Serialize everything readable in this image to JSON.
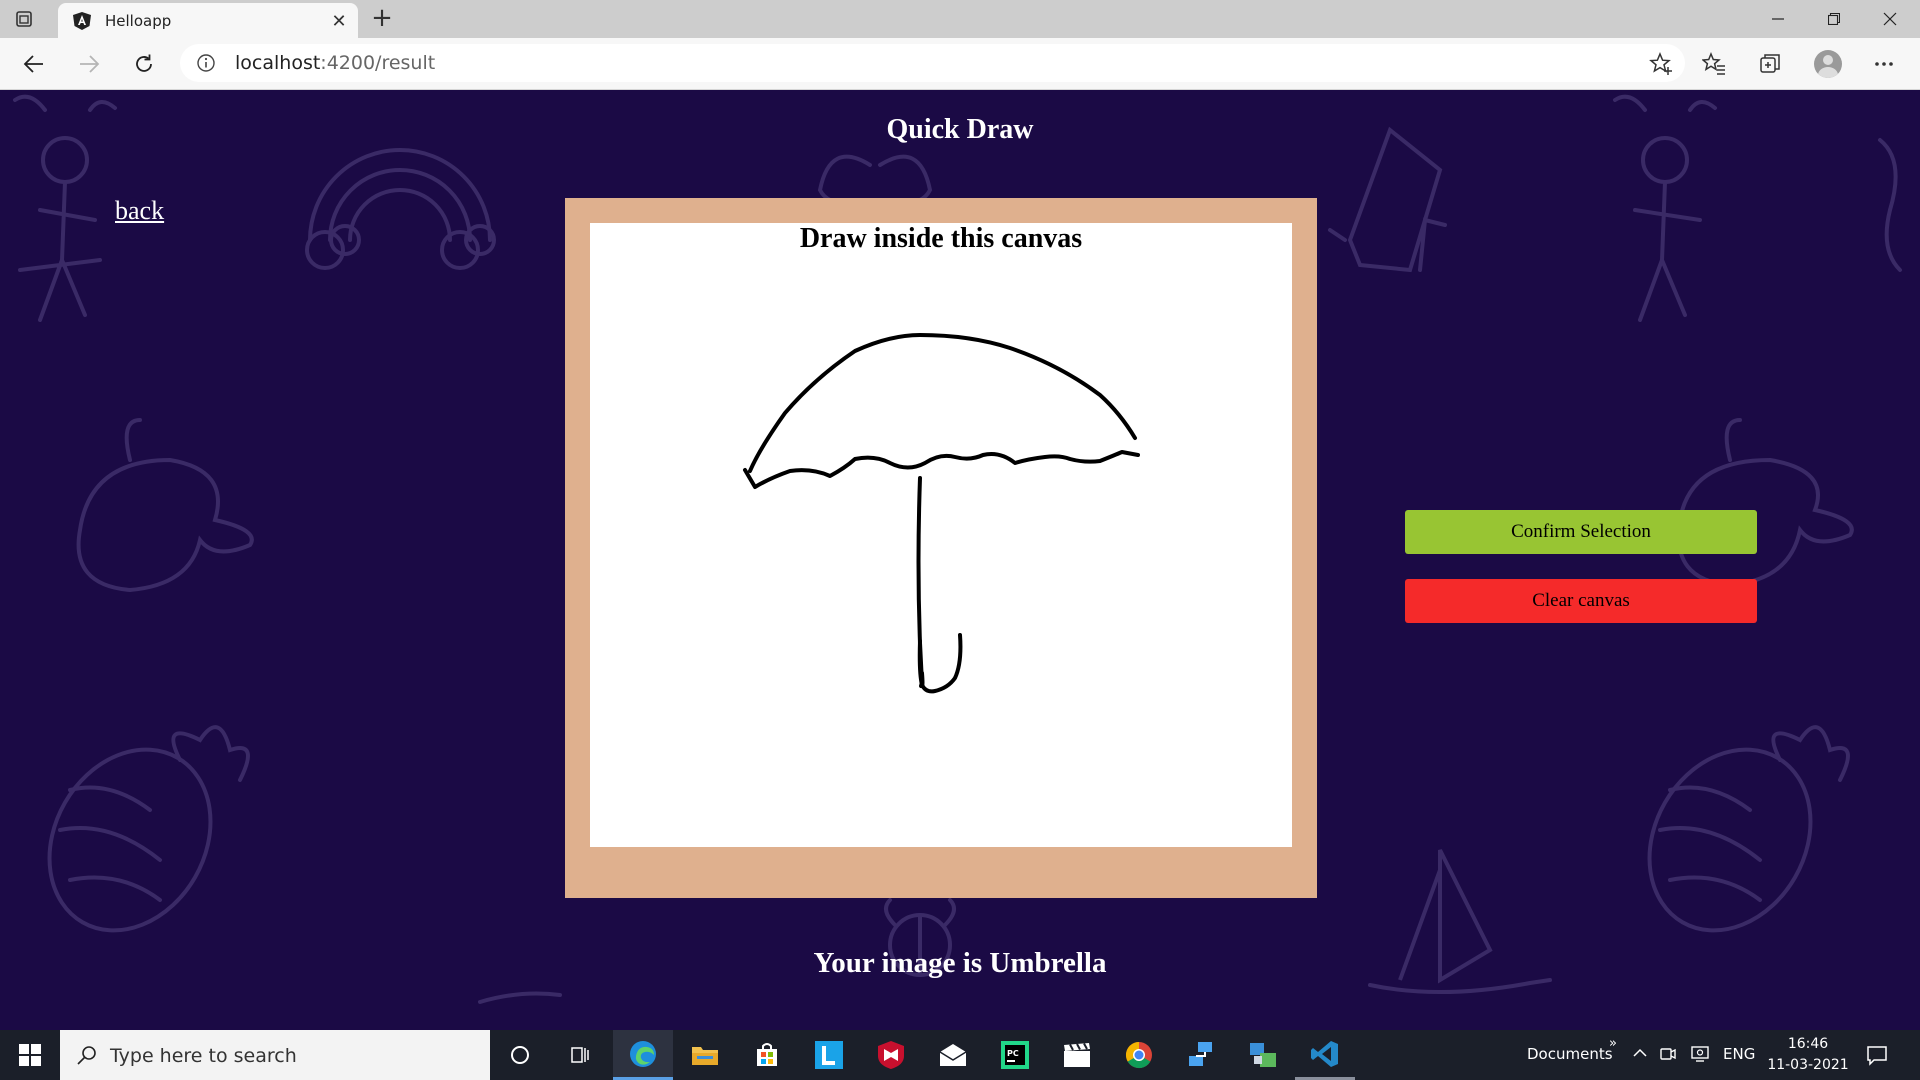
{
  "browser": {
    "tab_title": "Helloapp",
    "url_host": "localhost",
    "url_path": ":4200/result"
  },
  "page": {
    "title": "Quick Draw",
    "back_label": "back",
    "canvas_heading": "Draw inside this canvas",
    "confirm_label": "Confirm Selection",
    "clear_label": "Clear canvas",
    "result_text": "Your image is Umbrella"
  },
  "colors": {
    "page_background": "#1b0a45",
    "canvas_frame": "#dfb08e",
    "confirm_button": "#98c533",
    "clear_button": "#f52a2a"
  },
  "taskbar": {
    "search_placeholder": "Type here to search",
    "toolbar_label": "Documents",
    "language": "ENG",
    "time": "16:46",
    "date": "11-03-2021",
    "pinned_icons": [
      "task-view-icon",
      "widgets-icon",
      "edge-icon",
      "file-explorer-icon",
      "store-icon",
      "l-app-icon",
      "mcafee-icon",
      "mail-icon",
      "pycharm-icon",
      "video-editor-icon",
      "chrome-icon",
      "network-tool-icon",
      "remote-app-icon",
      "vscode-icon"
    ]
  }
}
